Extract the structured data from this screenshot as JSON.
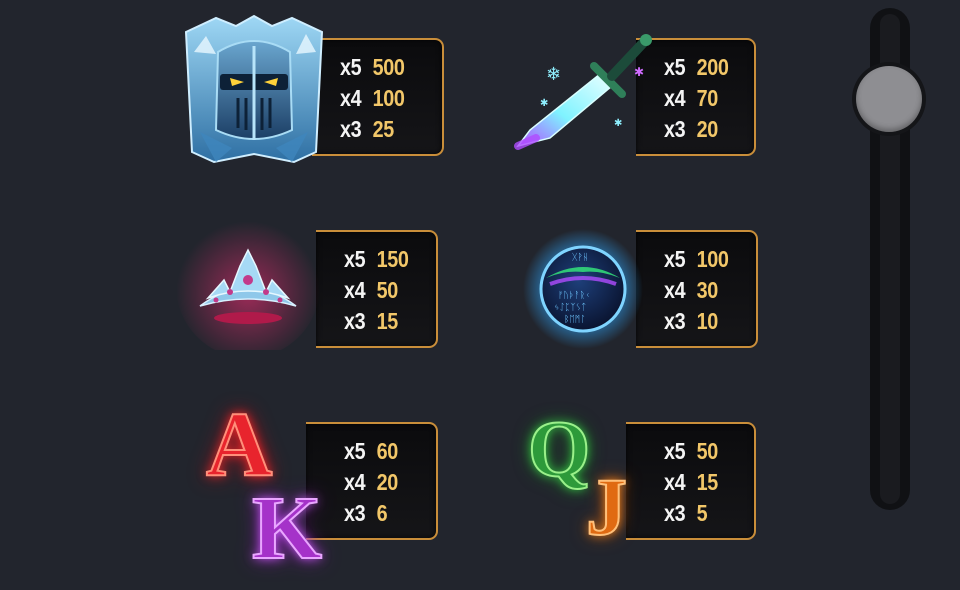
{
  "paytable": [
    {
      "id": "knight",
      "symbol_icon": "ice-knight-icon",
      "payouts": [
        {
          "mult": "x5",
          "value": "500"
        },
        {
          "mult": "x4",
          "value": "100"
        },
        {
          "mult": "x3",
          "value": "25"
        }
      ]
    },
    {
      "id": "sword",
      "symbol_icon": "ice-sword-icon",
      "payouts": [
        {
          "mult": "x5",
          "value": "200"
        },
        {
          "mult": "x4",
          "value": "70"
        },
        {
          "mult": "x3",
          "value": "20"
        }
      ]
    },
    {
      "id": "tiara",
      "symbol_icon": "tiara-icon",
      "payouts": [
        {
          "mult": "x5",
          "value": "150"
        },
        {
          "mult": "x4",
          "value": "50"
        },
        {
          "mult": "x3",
          "value": "15"
        }
      ]
    },
    {
      "id": "orb",
      "symbol_icon": "rune-orb-icon",
      "payouts": [
        {
          "mult": "x5",
          "value": "100"
        },
        {
          "mult": "x4",
          "value": "30"
        },
        {
          "mult": "x3",
          "value": "10"
        }
      ]
    },
    {
      "id": "ak",
      "symbol_icon": "letters-a-k-icon",
      "letters": [
        "A",
        "K"
      ],
      "payouts": [
        {
          "mult": "x5",
          "value": "60"
        },
        {
          "mult": "x4",
          "value": "20"
        },
        {
          "mult": "x3",
          "value": "6"
        }
      ]
    },
    {
      "id": "qj",
      "symbol_icon": "letters-q-j-icon",
      "letters": [
        "Q",
        "J"
      ],
      "payouts": [
        {
          "mult": "x5",
          "value": "50"
        },
        {
          "mult": "x4",
          "value": "15"
        },
        {
          "mult": "x3",
          "value": "5"
        }
      ]
    }
  ],
  "colors": {
    "background": "#22252d",
    "panel_border": "#c98e3a",
    "value_gold": "#f2c769",
    "mult_white": "#f4f4f4",
    "scroll_thumb": "#8e8e92"
  }
}
